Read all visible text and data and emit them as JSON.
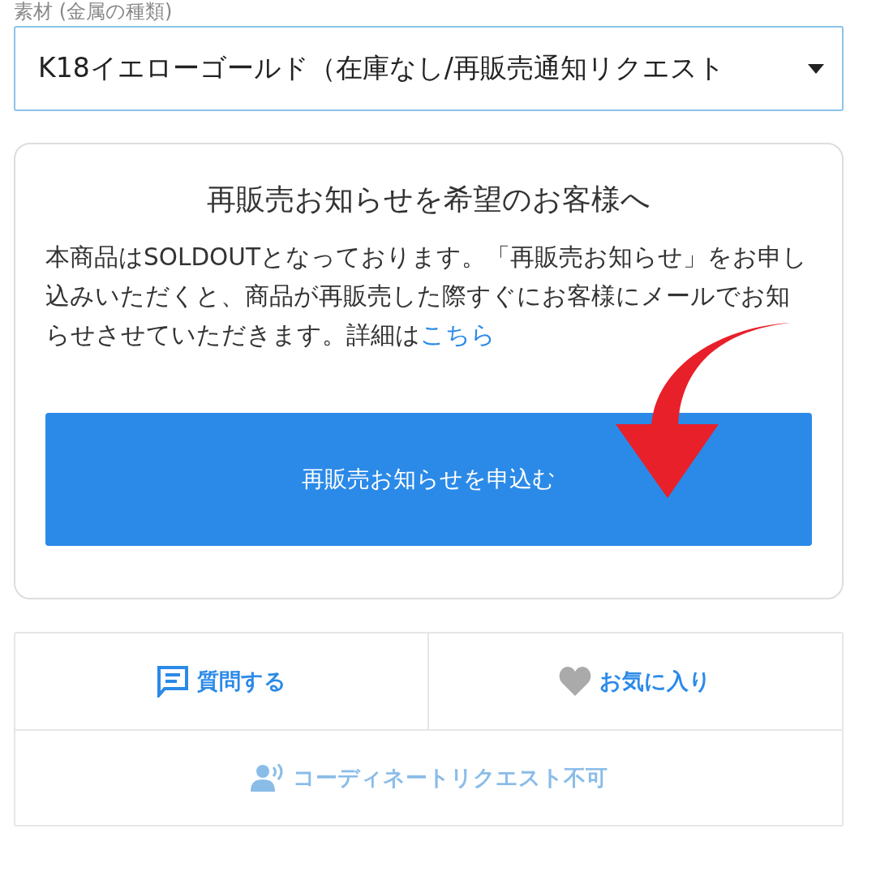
{
  "material_select": {
    "label": "素材 (金属の種類)",
    "value": "K18イエローゴールド（在庫なし/再販売通知リクエスト"
  },
  "restock_card": {
    "title": "再販売お知らせを希望のお客様へ",
    "body": "本商品はSOLDOUTとなっております。「再販売お知らせ」をお申し込みいただくと、商品が再販売した際すぐにお客様にメールでお知らせさせていただきます。詳細は",
    "link": "こちら",
    "button": "再販売お知らせを申込む"
  },
  "actions": {
    "question": "質問する",
    "favorite": {
      "label": "お気に入り",
      "favorited": false
    },
    "coordinate": {
      "label": "コーディネートリクエスト不可",
      "disabled": true
    }
  }
}
